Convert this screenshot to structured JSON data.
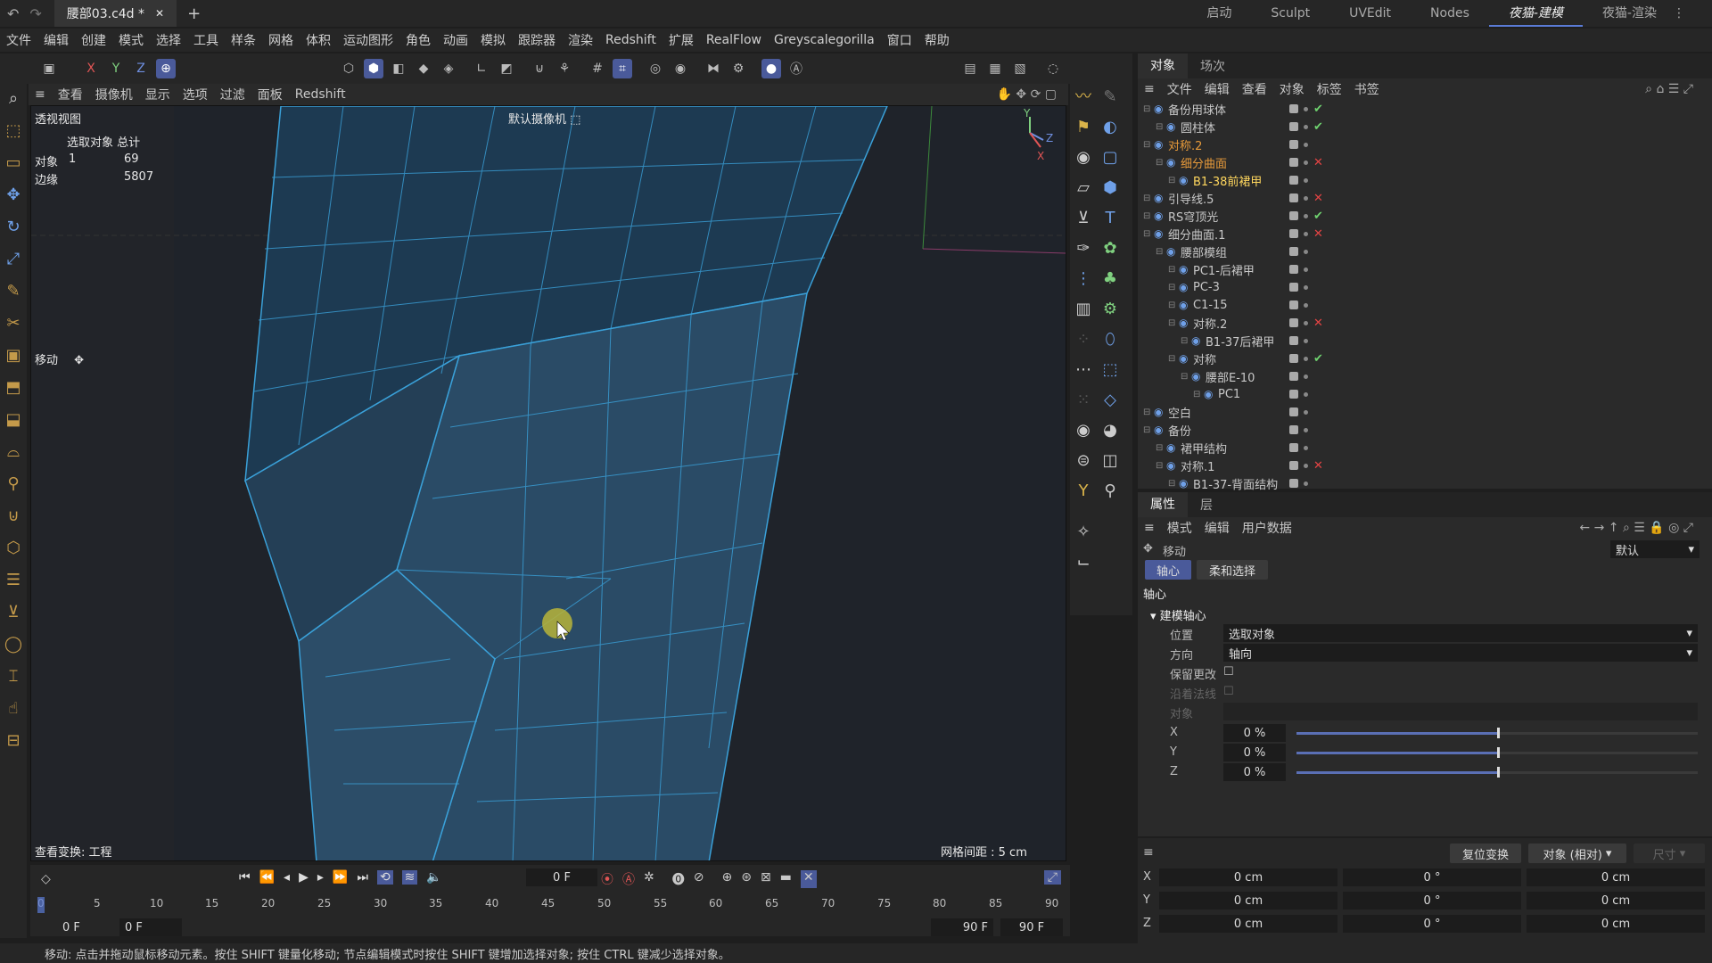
{
  "title_tab": "腰部03.c4d *",
  "layouts": [
    "启动",
    "Sculpt",
    "UVEdit",
    "Nodes",
    "夜猫-建模",
    "夜猫-渲染"
  ],
  "menu": [
    "文件",
    "编辑",
    "创建",
    "模式",
    "选择",
    "工具",
    "样条",
    "网格",
    "体积",
    "运动图形",
    "角色",
    "动画",
    "模拟",
    "跟踪器",
    "渲染",
    "Redshift",
    "扩展",
    "RealFlow",
    "Greyscalegorilla",
    "窗口",
    "帮助"
  ],
  "axes": [
    "X",
    "Y",
    "Z"
  ],
  "viewport": {
    "menu": [
      "查看",
      "摄像机",
      "显示",
      "选项",
      "过滤",
      "面板",
      "Redshift"
    ],
    "view_name": "透视视图",
    "camera": "默认摄像机",
    "stats_header": [
      "选取对象",
      "总计"
    ],
    "stats": [
      {
        "label": "对象",
        "sel": "1",
        "total": "69"
      },
      {
        "label": "边缘",
        "sel": "",
        "total": "5807"
      }
    ],
    "tool": "移动",
    "view_transform": "查看变换: 工程",
    "grid_spacing": "网格间距 : 5 cm"
  },
  "objects_panel": {
    "tabs": [
      "对象",
      "场次"
    ],
    "menu": [
      "文件",
      "编辑",
      "查看",
      "对象",
      "标签",
      "书签"
    ],
    "rows": [
      {
        "indent": 0,
        "name": "备份用球体",
        "color": "normal",
        "flag": "check"
      },
      {
        "indent": 1,
        "name": "圆柱体",
        "color": "normal",
        "flag": "check"
      },
      {
        "indent": 0,
        "name": "对称.2",
        "color": "orange",
        "flag": ""
      },
      {
        "indent": 1,
        "name": "细分曲面",
        "color": "orange",
        "flag": "cross"
      },
      {
        "indent": 2,
        "name": "B1-38前裙甲",
        "color": "yellow",
        "flag": ""
      },
      {
        "indent": 0,
        "name": "引导线.5",
        "color": "normal",
        "flag": "cross"
      },
      {
        "indent": 0,
        "name": "RS穹顶光",
        "color": "normal",
        "flag": "check"
      },
      {
        "indent": 0,
        "name": "细分曲面.1",
        "color": "normal",
        "flag": "cross"
      },
      {
        "indent": 1,
        "name": "腰部模组",
        "color": "normal",
        "flag": ""
      },
      {
        "indent": 2,
        "name": "PC1-后裙甲",
        "color": "normal",
        "flag": ""
      },
      {
        "indent": 2,
        "name": "PC-3",
        "color": "normal",
        "flag": ""
      },
      {
        "indent": 2,
        "name": "C1-15",
        "color": "normal",
        "flag": ""
      },
      {
        "indent": 2,
        "name": "对称.2",
        "color": "normal",
        "flag": "cross"
      },
      {
        "indent": 3,
        "name": "B1-37后裙甲",
        "color": "normal",
        "flag": ""
      },
      {
        "indent": 2,
        "name": "对称",
        "color": "normal",
        "flag": "check"
      },
      {
        "indent": 3,
        "name": "腰部E-10",
        "color": "normal",
        "flag": ""
      },
      {
        "indent": 4,
        "name": "PC1",
        "color": "normal",
        "flag": ""
      },
      {
        "indent": 0,
        "name": "空白",
        "color": "normal",
        "flag": ""
      },
      {
        "indent": 0,
        "name": "备份",
        "color": "normal",
        "flag": ""
      },
      {
        "indent": 1,
        "name": "裙甲结构",
        "color": "normal",
        "flag": ""
      },
      {
        "indent": 1,
        "name": "对称.1",
        "color": "normal",
        "flag": "cross"
      },
      {
        "indent": 2,
        "name": "B1-37-背面结构",
        "color": "normal",
        "flag": ""
      }
    ]
  },
  "attributes_panel": {
    "tabs": [
      "属性",
      "层"
    ],
    "menu": [
      "模式",
      "编辑",
      "用户数据"
    ],
    "tool": "移动",
    "preset": "默认",
    "subtabs": [
      "轴心",
      "柔和选择"
    ],
    "section": "轴心",
    "group": "建模轴心",
    "position_label": "位置",
    "position_value": "选取对象",
    "orientation_label": "方向",
    "orientation_value": "轴向",
    "keep_changes": "保留更改",
    "along_normal": "沿着法线",
    "object_label": "对象",
    "xyz": [
      {
        "axis": "X",
        "value": "0 %",
        "pct": 0.5
      },
      {
        "axis": "Y",
        "value": "0 %",
        "pct": 0.5
      },
      {
        "axis": "Z",
        "value": "0 %",
        "pct": 0.5
      }
    ]
  },
  "coord_panel": {
    "reset": "复位变换",
    "mode": "对象 (相对)",
    "size": "尺寸",
    "rows": [
      {
        "axis": "X",
        "pos": "0 cm",
        "rot": "0 °",
        "scale": "0 cm"
      },
      {
        "axis": "Y",
        "pos": "0 cm",
        "rot": "0 °",
        "scale": "0 cm"
      },
      {
        "axis": "Z",
        "pos": "0 cm",
        "rot": "0 °",
        "scale": "0 cm"
      }
    ]
  },
  "timeline": {
    "current_frame": "0 F",
    "ticks": [
      "0",
      "5",
      "10",
      "15",
      "20",
      "25",
      "30",
      "35",
      "40",
      "45",
      "50",
      "55",
      "60",
      "65",
      "70",
      "75",
      "80",
      "85",
      "90"
    ],
    "start": "0 F",
    "start2": "0 F",
    "end": "90 F",
    "end2": "90 F"
  },
  "status": "移动: 点击并拖动鼠标移动元素。按住 SHIFT 键量化移动; 节点编辑模式时按住 SHIFT 键增加选择对象; 按住 CTRL 键减少选择对象。",
  "colors": {
    "accent": "#5a7bd6",
    "mesh": "#3aa0d8",
    "orange": "#e79a3a",
    "yellow": "#ffd75e"
  }
}
